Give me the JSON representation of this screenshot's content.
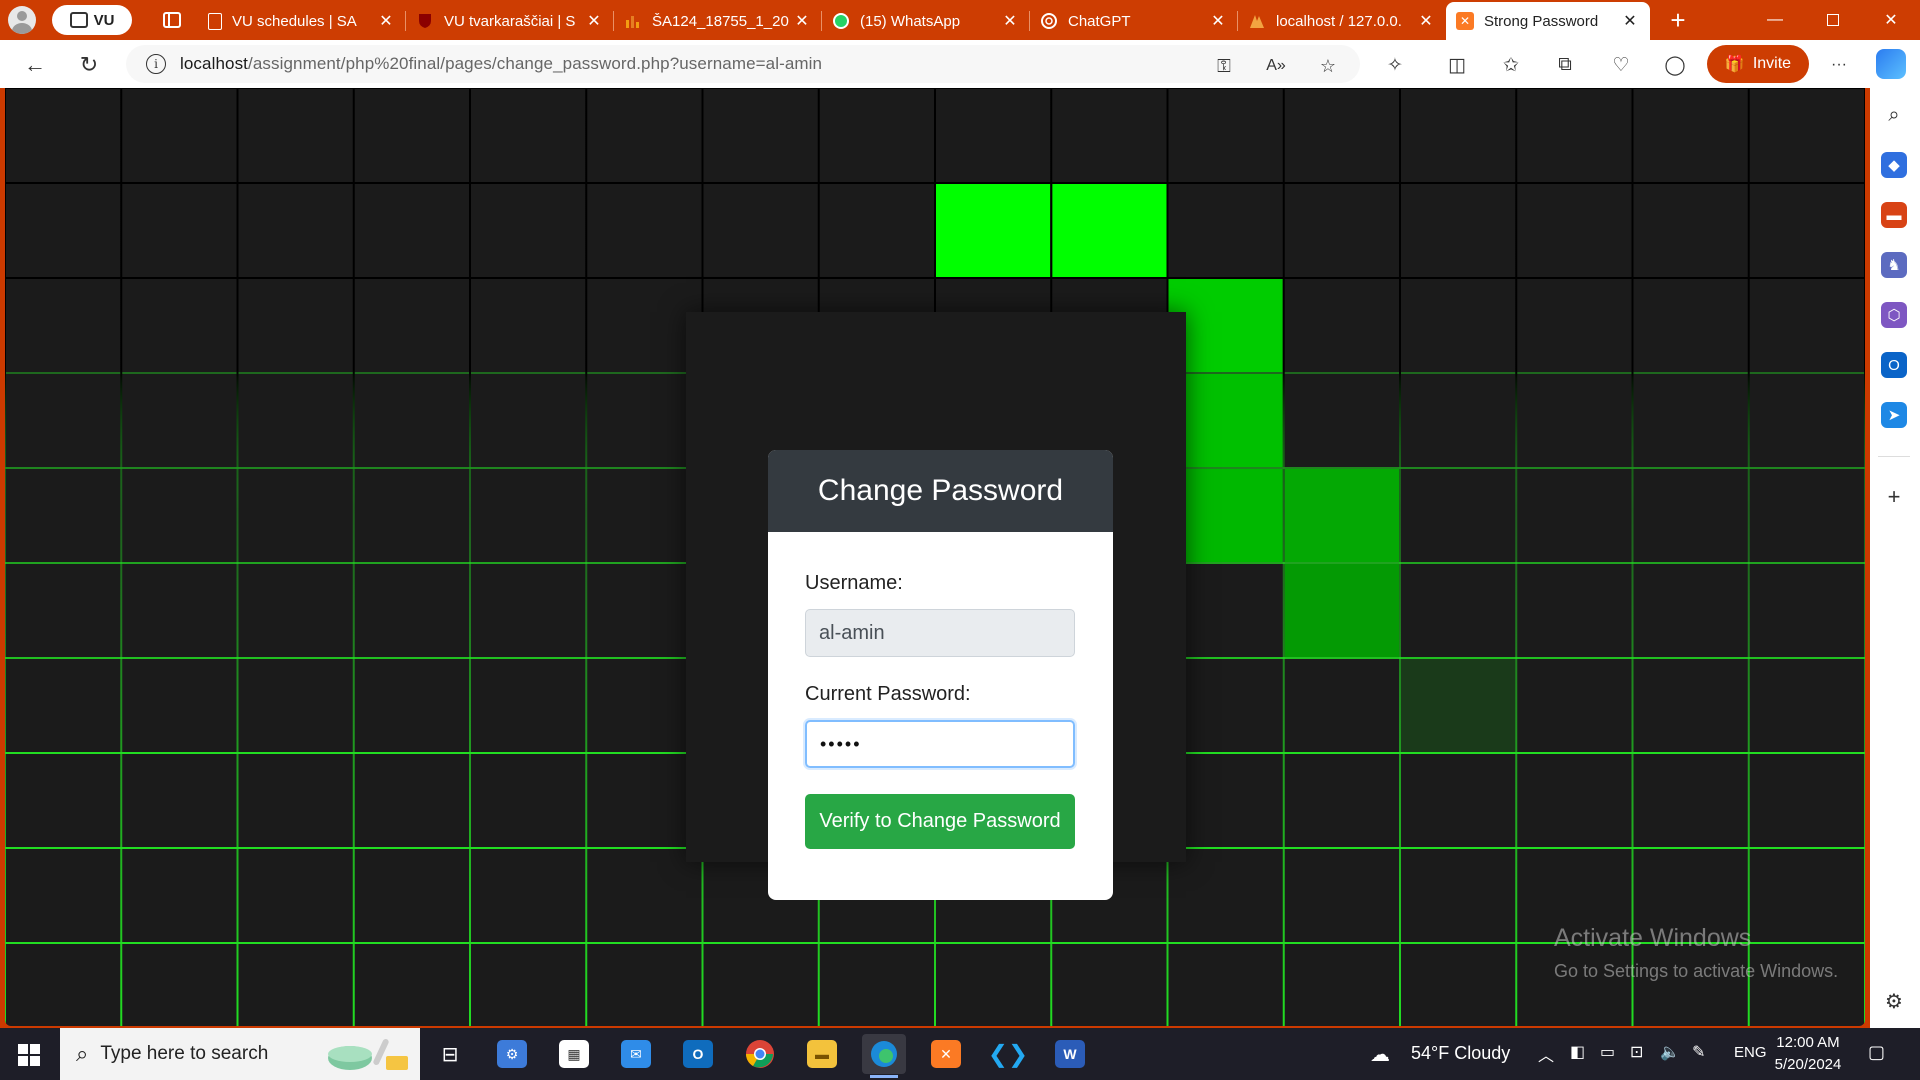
{
  "browser": {
    "workspace_label": "VU",
    "tabs": [
      {
        "title": "VU schedules | SA",
        "icon": "document-icon"
      },
      {
        "title": "VU tvarkaraščiai | S",
        "icon": "shield-icon"
      },
      {
        "title": "ŠA124_18755_1_20",
        "icon": "chart-icon"
      },
      {
        "title": "(15) WhatsApp",
        "icon": "whatsapp-icon"
      },
      {
        "title": "ChatGPT",
        "icon": "chatgpt-icon"
      },
      {
        "title": "localhost / 127.0.0.",
        "icon": "phpmyadmin-icon"
      },
      {
        "title": "Strong Password",
        "icon": "xampp-icon",
        "active": true
      }
    ],
    "close_glyph": "✕",
    "new_tab_glyph": "+",
    "url_host": "localhost",
    "url_path": "/assignment/php%20final/pages/change_password.php?username=al-amin",
    "invite_label": "Invite",
    "more_glyph": "···"
  },
  "page": {
    "card_title": "Change Password",
    "username_label": "Username:",
    "username_value": "al-amin",
    "current_password_label": "Current Password:",
    "current_password_value": "•••••",
    "verify_button": "Verify to Change Password",
    "accent_green": "#28a745",
    "header_bg": "#343a40"
  },
  "background_grid": {
    "columns": 16,
    "rows": 8,
    "line_color_bright": "#22dd22",
    "lit_cells": [
      {
        "col": 8,
        "row": 1,
        "color": "#00ff00"
      },
      {
        "col": 9,
        "row": 1,
        "color": "#00ff00"
      },
      {
        "col": 10,
        "row": 2,
        "color": "#00cc00"
      },
      {
        "col": 10,
        "row": 3,
        "color": "#00c000"
      },
      {
        "col": 10,
        "row": 4,
        "color": "#00b800"
      },
      {
        "col": 11,
        "row": 4,
        "color": "#04a804"
      },
      {
        "col": 11,
        "row": 5,
        "color": "#049a04"
      },
      {
        "col": 12,
        "row": 6,
        "color": "#1a3a1a"
      }
    ]
  },
  "watermark": {
    "line1": "Activate Windows",
    "line2": "Go to Settings to activate Windows."
  },
  "taskbar": {
    "search_placeholder": "Type here to search",
    "weather": "54°F  Cloudy",
    "language": "ENG",
    "time": "12:00 AM",
    "date": "5/20/2024"
  }
}
